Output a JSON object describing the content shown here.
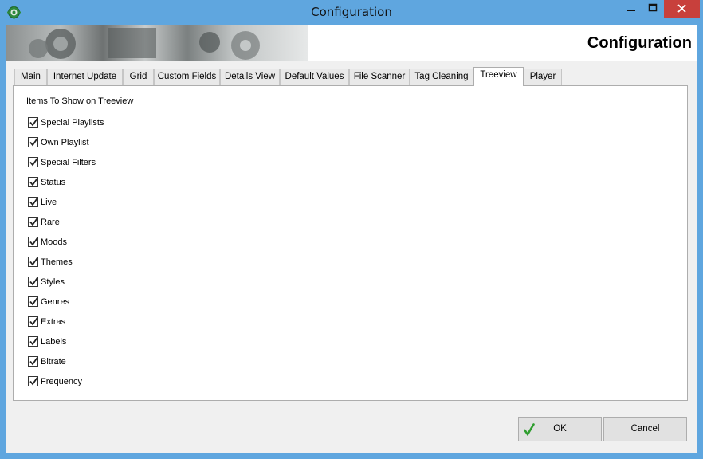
{
  "window": {
    "title": "Configuration",
    "app_icon": "gear-icon",
    "controls": [
      "minimize-icon",
      "maximize-icon",
      "close-icon"
    ],
    "close_color": "#c8403c",
    "titlebar_color": "#5fa6df"
  },
  "banner": {
    "title": "Configuration"
  },
  "tabs": [
    {
      "label": "Main"
    },
    {
      "label": "Internet Update"
    },
    {
      "label": "Grid"
    },
    {
      "label": "Custom Fields"
    },
    {
      "label": "Details View"
    },
    {
      "label": "Default Values"
    },
    {
      "label": "File Scanner"
    },
    {
      "label": "Tag Cleaning"
    },
    {
      "label": "Treeview",
      "selected": true
    },
    {
      "label": "Player"
    }
  ],
  "treeview": {
    "group_title": "Items To Show on Treeview",
    "items": [
      {
        "label": "Special Playlists",
        "checked": true
      },
      {
        "label": "Own Playlist",
        "checked": true
      },
      {
        "label": "Special Filters",
        "checked": true
      },
      {
        "label": "Status",
        "checked": true
      },
      {
        "label": "Live",
        "checked": true
      },
      {
        "label": "Rare",
        "checked": true
      },
      {
        "label": "Moods",
        "checked": true
      },
      {
        "label": "Themes",
        "checked": true
      },
      {
        "label": "Styles",
        "checked": true
      },
      {
        "label": "Genres",
        "checked": true
      },
      {
        "label": "Extras",
        "checked": true
      },
      {
        "label": "Labels",
        "checked": true
      },
      {
        "label": "Bitrate",
        "checked": true
      },
      {
        "label": "Frequency",
        "checked": true
      }
    ]
  },
  "buttons": {
    "ok_label": "OK",
    "ok_icon": "checkmark-icon",
    "cancel_label": "Cancel"
  }
}
